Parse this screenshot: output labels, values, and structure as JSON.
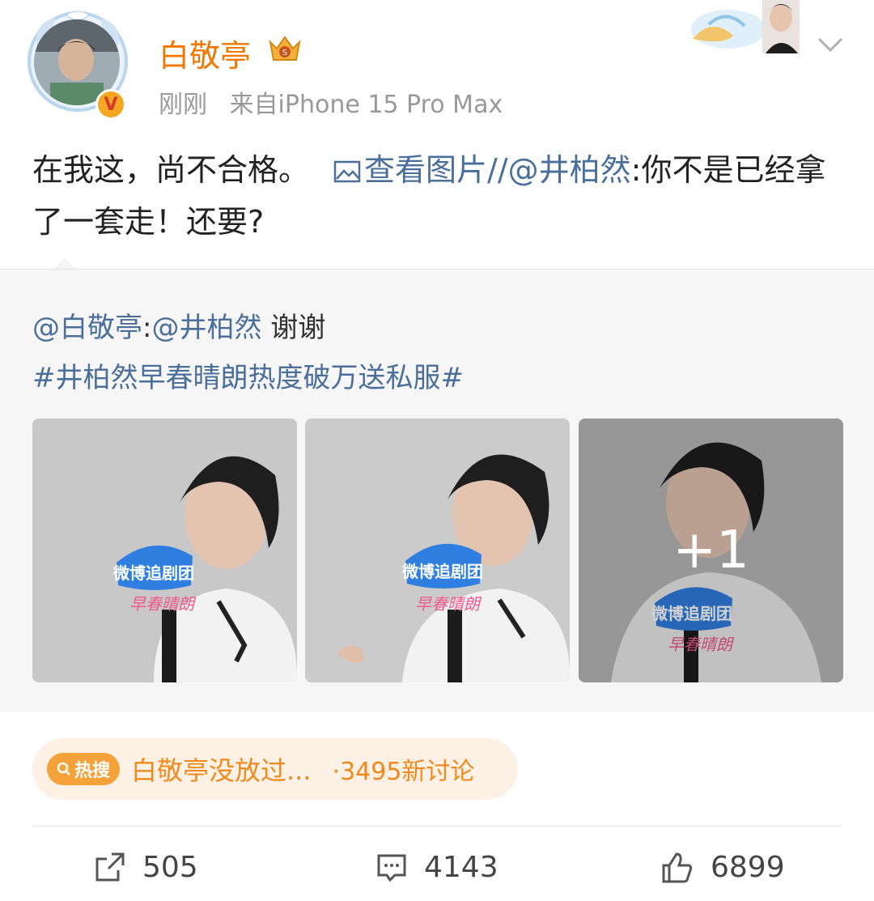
{
  "header": {
    "username": "白敬亭",
    "time": "刚刚",
    "source": "来自iPhone 15 Pro Max",
    "verified_mark": "V",
    "icons": [
      "avatar-frame",
      "verified-badge",
      "vip-crown-badge",
      "card-decoration",
      "chevron-down-icon"
    ]
  },
  "post": {
    "text": "在我这，尚不合格。",
    "view_image_label": "查看图片",
    "repost_prefix": "//",
    "mention": "@井柏然",
    "reply_text": ":你不是已经拿了一套走！还要?"
  },
  "repost": {
    "author": "@白敬亭",
    "colon": ":",
    "mention": "@井柏然",
    "text": " 谢谢",
    "hashtag": "#井柏然早春晴朗热度破万送私服#",
    "images": [
      {
        "overlay_badge": "微博追剧团",
        "show": "早春晴朗"
      },
      {
        "overlay_badge": "微博追剧团",
        "show": "早春晴朗"
      },
      {
        "overlay_badge": "微博追剧团",
        "show": "早春晴朗"
      }
    ],
    "more_count": "+1"
  },
  "hot_search": {
    "tag": "热搜",
    "title": "白敬亭没放过...",
    "count": "·3495新讨论"
  },
  "actions": {
    "repost_count": "505",
    "comment_count": "4143",
    "like_count": "6899"
  },
  "colors": {
    "username": "#f07800",
    "link": "#4a6f9a",
    "hot_bg": "#fdf0e4",
    "hot_tag": "#f6a23a"
  }
}
